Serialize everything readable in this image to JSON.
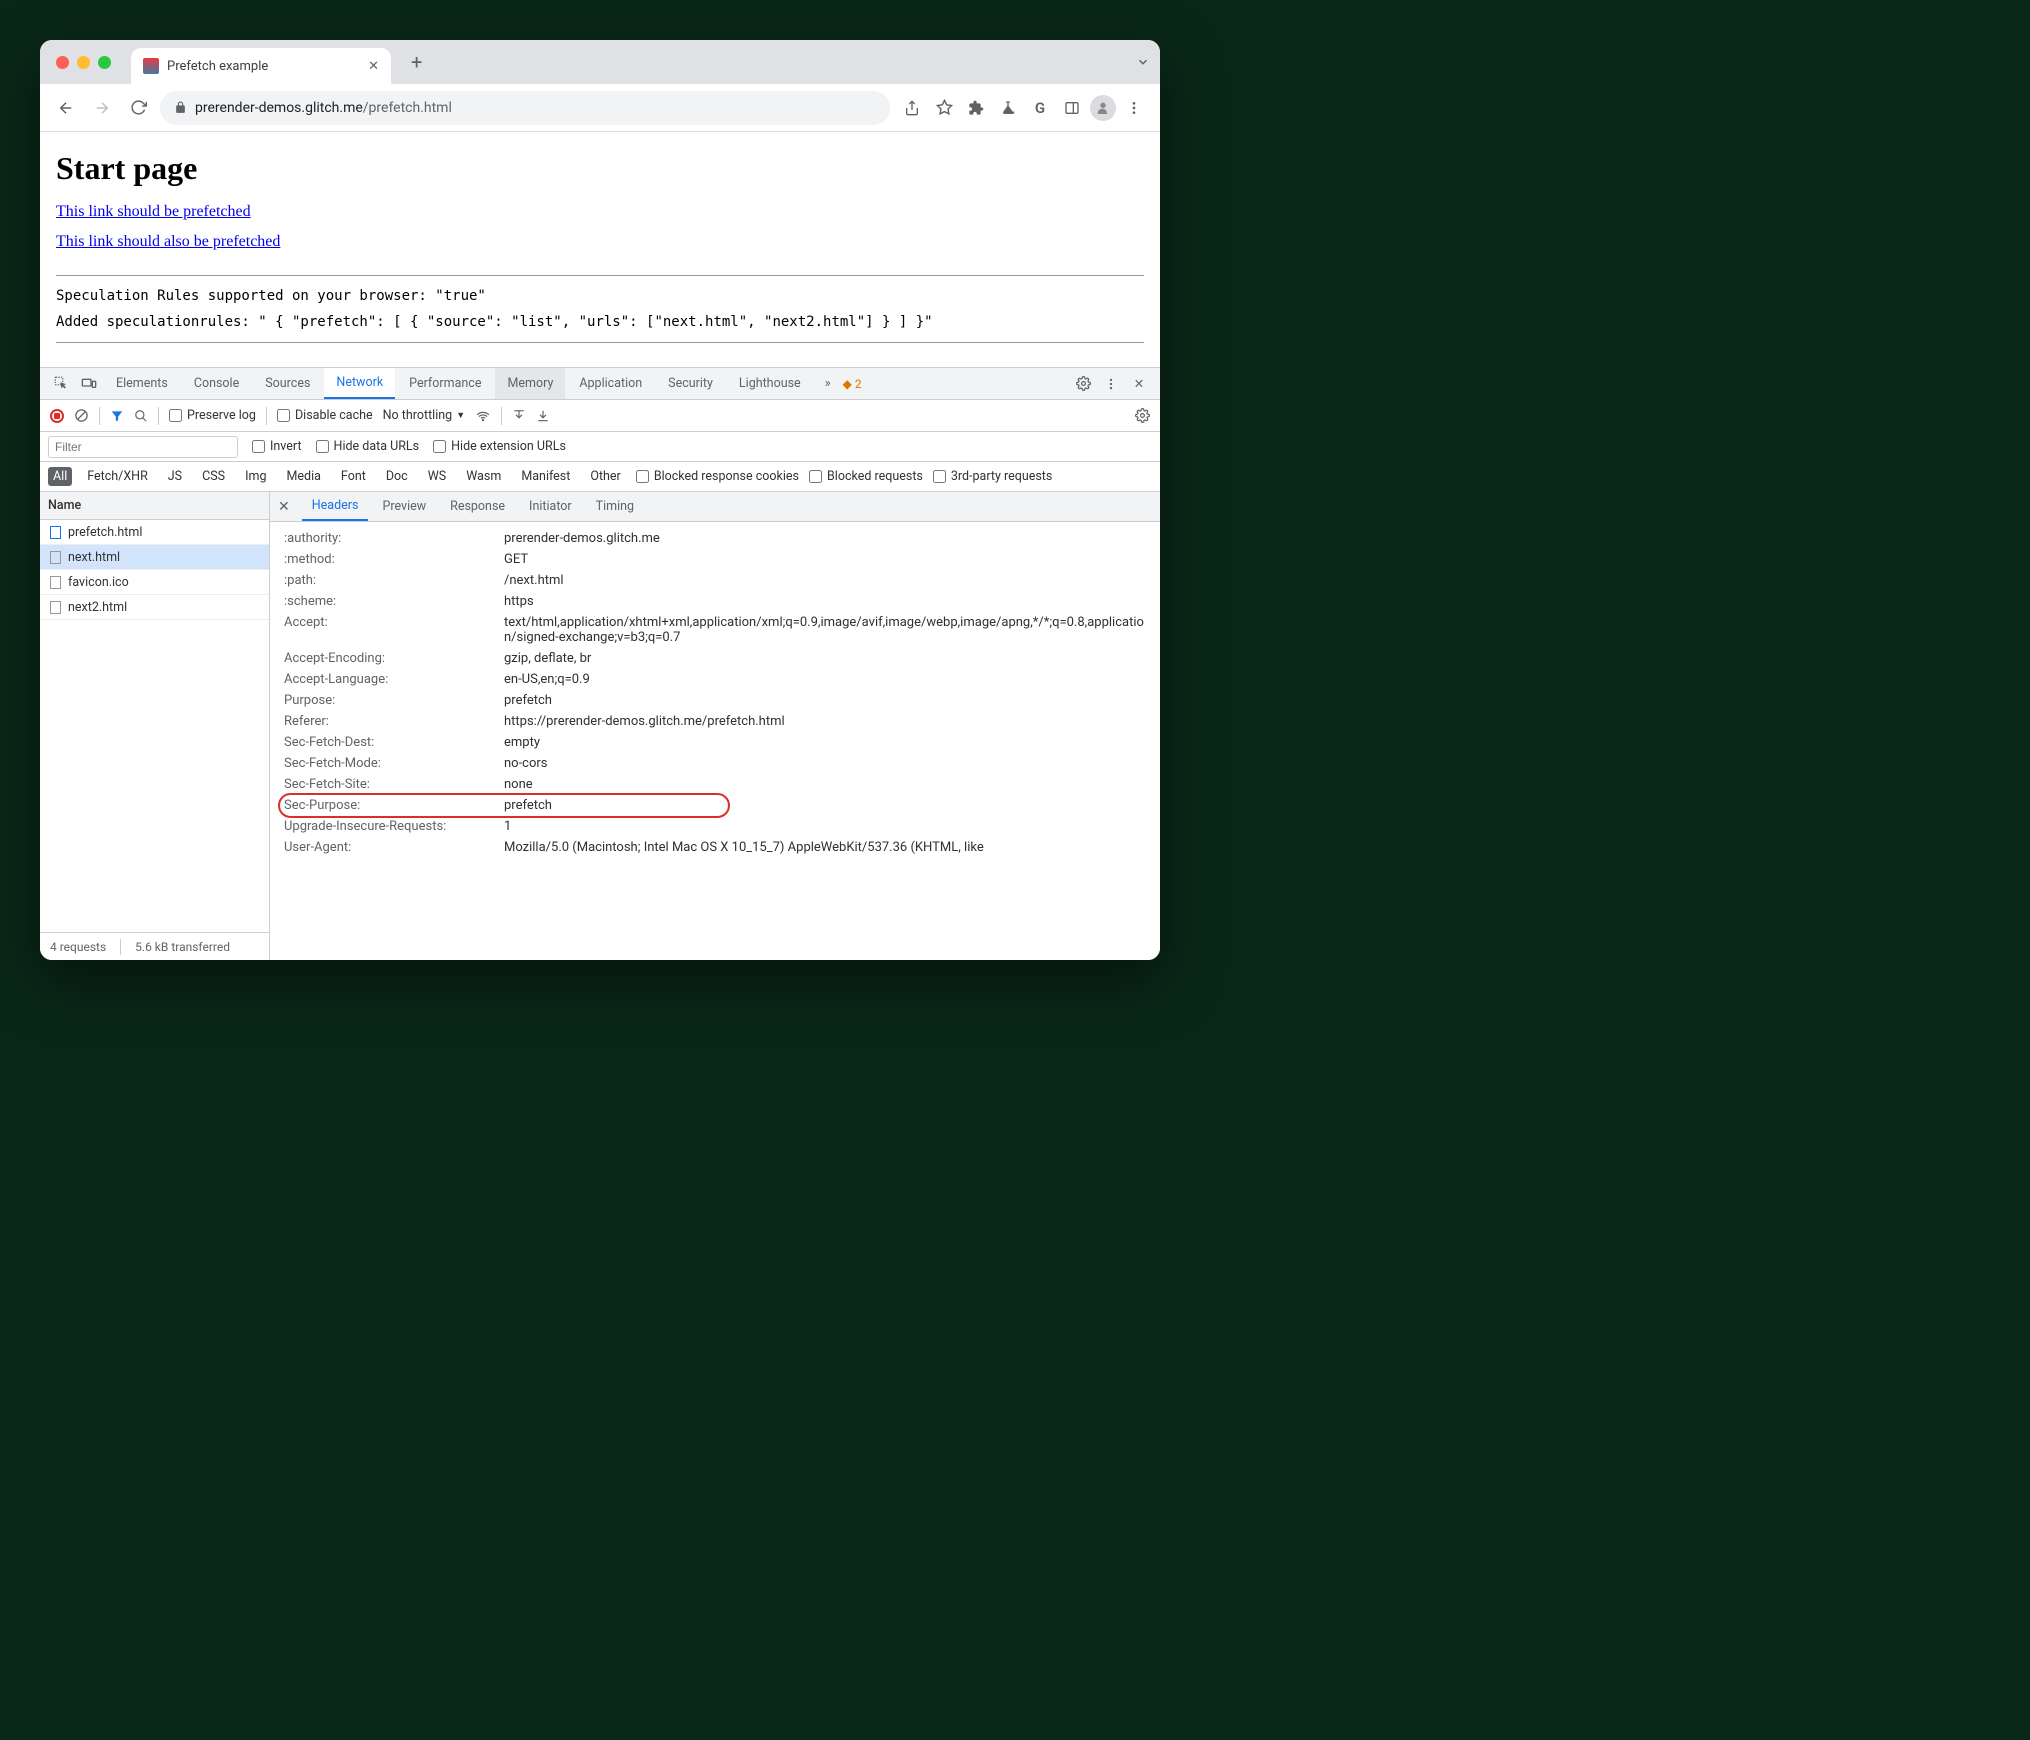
{
  "tab": {
    "title": "Prefetch example"
  },
  "url": {
    "host": "prerender-demos.glitch.me",
    "path": "/prefetch.html"
  },
  "page": {
    "heading": "Start page",
    "link1": "This link should be prefetched",
    "link2": "This link should also be prefetched",
    "spec_line": "Speculation Rules supported on your browser: \"true\"",
    "added_line": "Added speculationrules: \" { \"prefetch\": [ { \"source\": \"list\", \"urls\": [\"next.html\", \"next2.html\"] } ] }\""
  },
  "devtools": {
    "panels": [
      "Elements",
      "Console",
      "Sources",
      "Network",
      "Performance",
      "Memory",
      "Application",
      "Security",
      "Lighthouse"
    ],
    "active_panel": "Network",
    "warn_count": "2",
    "network_toolbar": {
      "preserve_log": "Preserve log",
      "disable_cache": "Disable cache",
      "throttling": "No throttling"
    },
    "filter_placeholder": "Filter",
    "filter_checks": {
      "invert": "Invert",
      "hide_data": "Hide data URLs",
      "hide_ext": "Hide extension URLs"
    },
    "types": [
      "All",
      "Fetch/XHR",
      "JS",
      "CSS",
      "Img",
      "Media",
      "Font",
      "Doc",
      "WS",
      "Wasm",
      "Manifest",
      "Other"
    ],
    "type_checks": {
      "blocked_cookies": "Blocked response cookies",
      "blocked_req": "Blocked requests",
      "third": "3rd-party requests"
    },
    "name_col": "Name",
    "requests": [
      {
        "name": "prefetch.html",
        "icon": "doc"
      },
      {
        "name": "next.html",
        "icon": "other",
        "selected": true
      },
      {
        "name": "favicon.ico",
        "icon": "other"
      },
      {
        "name": "next2.html",
        "icon": "other"
      }
    ],
    "detail_tabs": [
      "Headers",
      "Preview",
      "Response",
      "Initiator",
      "Timing"
    ],
    "headers": [
      {
        "k": ":authority:",
        "v": "prerender-demos.glitch.me"
      },
      {
        "k": ":method:",
        "v": "GET"
      },
      {
        "k": ":path:",
        "v": "/next.html"
      },
      {
        "k": ":scheme:",
        "v": "https"
      },
      {
        "k": "Accept:",
        "v": "text/html,application/xhtml+xml,application/xml;q=0.9,image/avif,image/webp,image/apng,*/*;q=0.8,application/signed-exchange;v=b3;q=0.7"
      },
      {
        "k": "Accept-Encoding:",
        "v": "gzip, deflate, br"
      },
      {
        "k": "Accept-Language:",
        "v": "en-US,en;q=0.9"
      },
      {
        "k": "Purpose:",
        "v": "prefetch"
      },
      {
        "k": "Referer:",
        "v": "https://prerender-demos.glitch.me/prefetch.html"
      },
      {
        "k": "Sec-Fetch-Dest:",
        "v": "empty"
      },
      {
        "k": "Sec-Fetch-Mode:",
        "v": "no-cors"
      },
      {
        "k": "Sec-Fetch-Site:",
        "v": "none"
      },
      {
        "k": "Sec-Purpose:",
        "v": "prefetch",
        "highlight": true
      },
      {
        "k": "Upgrade-Insecure-Requests:",
        "v": "1"
      },
      {
        "k": "User-Agent:",
        "v": "Mozilla/5.0 (Macintosh; Intel Mac OS X 10_15_7) AppleWebKit/537.36 (KHTML, like"
      }
    ],
    "status": {
      "requests": "4 requests",
      "transfer": "5.6 kB transferred"
    }
  }
}
